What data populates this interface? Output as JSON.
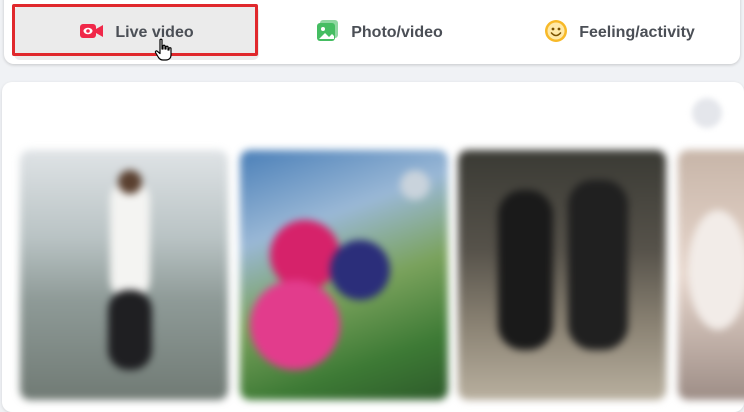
{
  "composer": {
    "actions": [
      {
        "label": "Live video",
        "icon": "live-video-icon",
        "color": "#f02849"
      },
      {
        "label": "Photo/video",
        "icon": "photo-video-icon",
        "color": "#45bd62"
      },
      {
        "label": "Feeling/activity",
        "icon": "feeling-activity-icon",
        "color": "#f7b928"
      }
    ],
    "highlight_color": "#e0282c"
  },
  "stories": {
    "title": "",
    "cards": [
      {
        "name": ""
      },
      {
        "name": ""
      },
      {
        "name": ""
      },
      {
        "name": ""
      }
    ]
  }
}
